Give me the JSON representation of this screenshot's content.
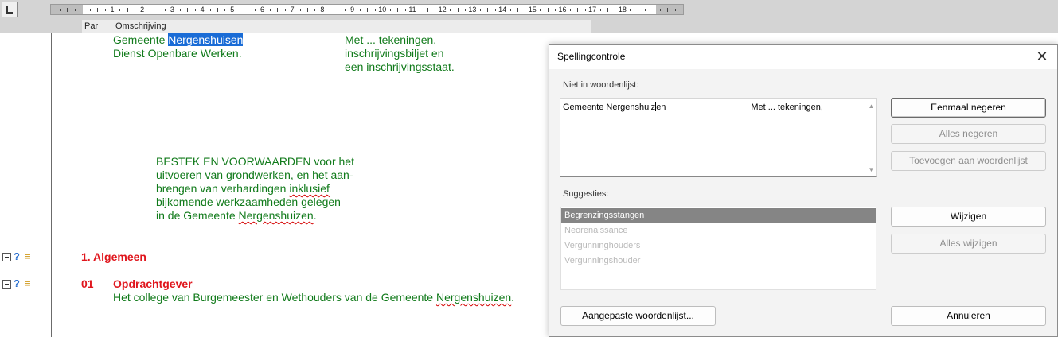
{
  "ruler": {
    "numbers": [
      "1",
      "2",
      "3",
      "4",
      "5",
      "6",
      "7",
      "8",
      "9",
      "10",
      "11",
      "12",
      "13",
      "14",
      "15",
      "16",
      "17",
      "18"
    ]
  },
  "columns": {
    "par": "Par",
    "omschrijving": "Omschrijving"
  },
  "document": {
    "header_left": {
      "line1_prefix": "Gemeente ",
      "line1_selected": "Nergenshuisen",
      "line2": "Dienst Openbare Werken."
    },
    "header_right": {
      "line1": "Met ... tekeningen,",
      "line2": "inschrijvingsbiljet en",
      "line3": "een inschrijvingsstaat."
    },
    "title": {
      "line1": "BESTEK EN VOORWAARDEN voor het",
      "line2": "uitvoeren van grondwerken, en het aan-",
      "line3_prefix": "brengen van verhardingen ",
      "line3_misspelled": "inklusief",
      "line4": "bijkomende werkzaamheden gelegen",
      "line5_prefix": "in de Gemeente ",
      "line5_misspelled": "Nergenshuizen",
      "line5_suffix": "."
    },
    "section1": {
      "label": "1. Algemeen"
    },
    "section01": {
      "number": "01",
      "heading": "Opdrachtgever",
      "text_prefix": "Het college van Burgemeester en Wethouders van de Gemeente ",
      "text_misspelled": "Nergenshuizen",
      "text_suffix": "."
    }
  },
  "dialog": {
    "title": "Spellingcontrole",
    "not_in_dictionary_label": "Niet in woordenlijst:",
    "context_before_caret": "Gemeente Nergenshuiz",
    "context_after_caret": "en                                   Met ... tekeningen,",
    "suggestions_label": "Suggesties:",
    "suggestions": [
      "Begrenzingsstangen",
      "Neorenaissance",
      "Vergunninghouders",
      "Vergunningshouder"
    ],
    "buttons": {
      "ignore_once": "Eenmaal negeren",
      "ignore_all": "Alles negeren",
      "add_to_dictionary": "Toevoegen aan woordenlijst",
      "change": "Wijzigen",
      "change_all": "Alles wijzigen",
      "custom_dictionary": "Aangepaste woordenlijst...",
      "cancel": "Annuleren"
    }
  },
  "colors": {
    "document_text": "#107a1a",
    "heading_text": "#e0161d",
    "selection": "#1a6cd6"
  }
}
